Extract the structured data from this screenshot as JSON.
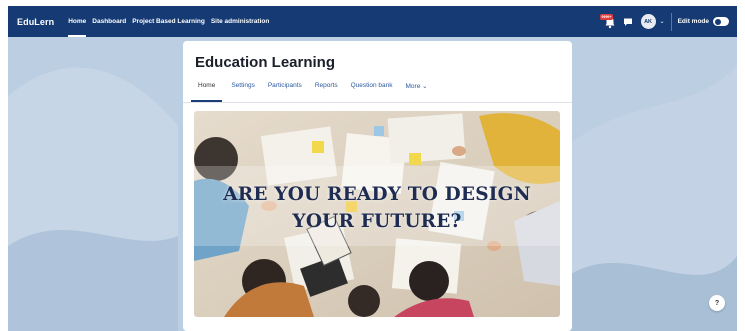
{
  "navbar": {
    "brand": "EduLern",
    "links": [
      {
        "label": "Home",
        "active": true
      },
      {
        "label": "Dashboard",
        "active": false
      },
      {
        "label": "Project Based Learning",
        "active": false
      },
      {
        "label": "Site administration",
        "active": false
      }
    ],
    "notification_badge": "9999+",
    "avatar_initials": "AK",
    "edit_mode_label": "Edit mode"
  },
  "course": {
    "title": "Education Learning",
    "tabs": [
      {
        "label": "Home",
        "active": true
      },
      {
        "label": "Settings"
      },
      {
        "label": "Participants"
      },
      {
        "label": "Reports"
      },
      {
        "label": "Question bank"
      },
      {
        "label": "More ⌄"
      }
    ]
  },
  "banner": {
    "line1": "ARE YOU READY TO DESIGN",
    "line2": "YOUR FUTURE?"
  },
  "help": {
    "label": "?"
  },
  "colors": {
    "navbar": "#163a73",
    "background": "#b9cde0",
    "accent": "#2c5aa0"
  }
}
